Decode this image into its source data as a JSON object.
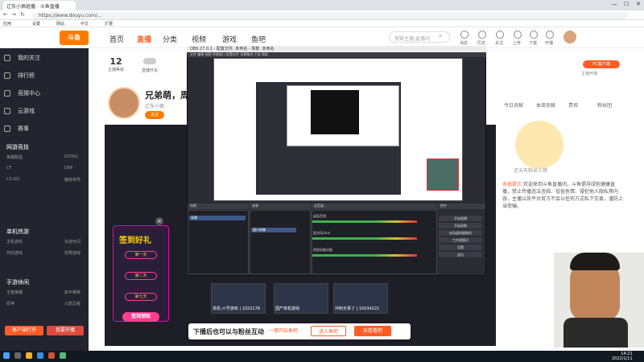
{
  "browser": {
    "tab_title": "辽东小佩姐播 · 斗鱼直播",
    "url": "https://www.douyu.com/...",
    "bookmarks": [
      "应用",
      "设置",
      "网站",
      "中文",
      "扩展"
    ]
  },
  "header": {
    "logo": "斗鱼",
    "nav": [
      "首页",
      "直播",
      "分类",
      "视频",
      "游戏",
      "鱼吧"
    ],
    "search_placeholder": "搜索主播/直播间",
    "icons": [
      {
        "name": "message-icon",
        "label": "消息"
      },
      {
        "name": "history-icon",
        "label": "历史"
      },
      {
        "name": "follow-icon",
        "label": "关注"
      },
      {
        "name": "upload-icon",
        "label": "上传"
      },
      {
        "name": "download-icon",
        "label": "下载"
      },
      {
        "name": "live-icon",
        "label": "开播"
      }
    ]
  },
  "sidebar": {
    "items": [
      {
        "label": "我的关注",
        "icon": "heart-icon"
      },
      {
        "label": "排行榜",
        "icon": "rank-icon"
      },
      {
        "label": "竞猜中心",
        "icon": "quiz-icon"
      },
      {
        "label": "云游戏",
        "icon": "cloud-game-icon"
      },
      {
        "label": "赛事",
        "icon": "trophy-icon"
      }
    ],
    "sections": [
      {
        "title": "网游竞技",
        "subs": [
          "英雄联盟",
          "DOTA2",
          "CF",
          "DNF",
          "CS:GO",
          "魔兽世界"
        ]
      },
      {
        "title": "单机热游",
        "subs": [
          "主机游戏",
          "永劫无间",
          "怀旧游戏",
          "恐怖游戏"
        ]
      },
      {
        "title": "手游休闲",
        "subs": [
          "王者荣耀",
          "和平精英",
          "原神",
          "火影忍者"
        ]
      }
    ],
    "btn_left": "客户端打开",
    "btn_right": "我要开播"
  },
  "room": {
    "stats": [
      {
        "value": "12",
        "label": "主播等级"
      },
      {
        "value": "",
        "label": "直播开关"
      }
    ],
    "title": "兄弟萌，周二快乐",
    "tag": "辽东小佩",
    "follow_label": "关注",
    "title_caption": "兄弟萌，周二..."
  },
  "right": {
    "buttons": [
      {
        "label": "PC客户端"
      },
      {
        "label": "主播开播"
      }
    ],
    "tabs": [
      "今日贡献",
      "本周贡献",
      "贵宾",
      "粉丝团"
    ],
    "mascot_caption": "还未有粉丝上榜",
    "notice_label": "系统提示",
    "notice_text": "欢迎来到斗鱼直播间，斗鱼倡导绿色健康直播，禁止传播违法违规、低俗色情、侵犯他人隐私等内容，主播以及平台官方不会以任何方式私下交易，谨防上当受骗。"
  },
  "obs": {
    "title": "OBS 27.0.1 - 配置文件: 未命名 - 场景: 未命名",
    "menu": [
      "文件",
      "编辑",
      "视图",
      "停靠窗口",
      "配置文件",
      "场景集合",
      "工具",
      "帮助"
    ],
    "docks": [
      "场景",
      "来源",
      "混音器",
      "转场特效",
      "控件"
    ],
    "scene_selected": "场景",
    "source_selected": "窗口采集",
    "mixer_tracks": [
      "桌面音频",
      "麦克风/Aux",
      "视频采集设备"
    ],
    "controls": [
      "开始直播",
      "开始录制",
      "启动虚拟摄像机",
      "工作室模式",
      "设置",
      "退出"
    ]
  },
  "ad": {
    "title": "签到好礼",
    "rows": [
      "第一天",
      "第二天",
      "第七天"
    ],
    "claim": "签到领取",
    "close": "×"
  },
  "thumbs": [
    {
      "caption": "单机-六号游戏 | 1022178"
    },
    {
      "caption": "国产单机游戏"
    },
    {
      "caption": "冲刺无事了 | 10034221"
    }
  ],
  "prompt": {
    "text": "下播后也可以与粉丝互动",
    "btn1": "一键开启鱼吧",
    "btn2": "进入鱼吧",
    "btn3": "去看看吧"
  },
  "taskbar": {
    "time": "14:21",
    "date": "2022/1/11"
  },
  "colors": {
    "brand": "#ff5d23",
    "sidebar_bg": "#24242e",
    "obs_bg": "#2b2b33"
  }
}
